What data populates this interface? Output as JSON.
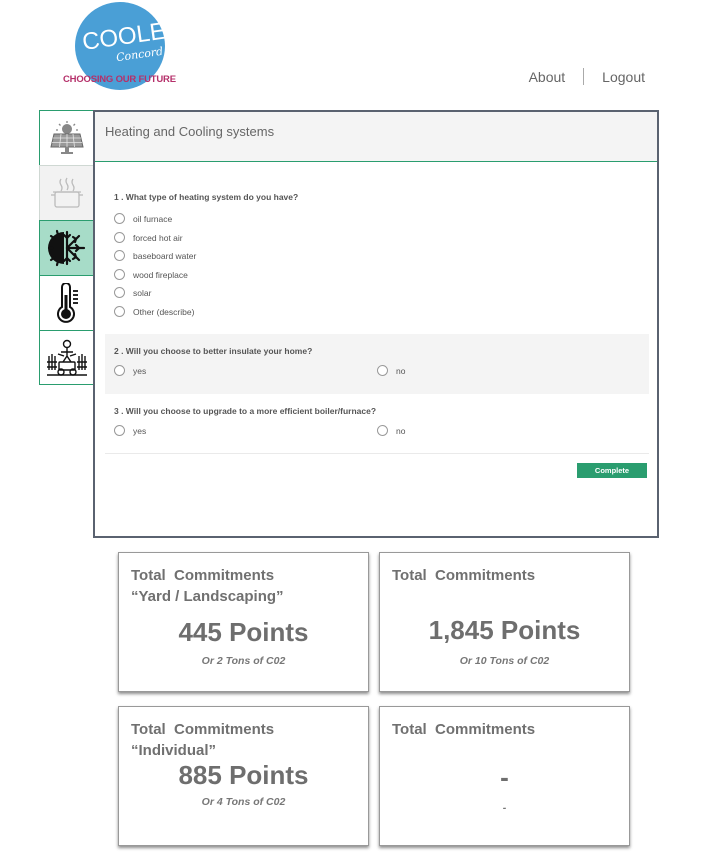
{
  "header": {
    "logo": {
      "line1": "COOLER",
      "line2": "Concord",
      "tagline": "CHOOSING OUR FUTURE"
    },
    "nav": [
      {
        "label": "About"
      },
      {
        "label": "Logout"
      }
    ]
  },
  "sidebar": {
    "items": [
      {
        "icon": "solar-panel-icon",
        "state": "normal"
      },
      {
        "icon": "cooking-pot-icon",
        "state": "faded"
      },
      {
        "icon": "heating-cooling-icon",
        "state": "active"
      },
      {
        "icon": "thermometer-icon",
        "state": "normal"
      },
      {
        "icon": "lawn-mower-icon",
        "state": "normal"
      }
    ]
  },
  "panel": {
    "title": "Heating and Cooling systems",
    "questions": [
      {
        "title": "1 .  What type of heating system do you have?",
        "options": [
          "oil furnace",
          "forced hot air",
          "baseboard water",
          "wood fireplace",
          "solar",
          "Other (describe)"
        ]
      },
      {
        "title": "2 .  Will you choose to better insulate your home?",
        "options": [
          "yes",
          "no"
        ]
      },
      {
        "title": "3 .  Will you choose to upgrade to a more efficient boiler/furnace?",
        "options": [
          "yes",
          "no"
        ]
      }
    ],
    "complete_label": "Complete"
  },
  "cards": [
    {
      "header": "Total  Commitments\n“Yard / Landscaping”",
      "points": "445 Points",
      "sub": "Or 2 Tons of C02"
    },
    {
      "header": "Total  Commitments",
      "points": "1,845 Points",
      "sub": "Or 10 Tons of C02"
    },
    {
      "header": "Total  Commitments\n“Individual”",
      "points": "885 Points",
      "sub": "Or 4 Tons of C02"
    },
    {
      "header": "Total  Commitments",
      "points": "-",
      "sub": "-"
    }
  ],
  "colors": {
    "accent": "#2a9d6f",
    "active_tab": "#a7dcc8",
    "logo_blue": "#4a9fd6",
    "logo_magenta": "#b5306a"
  }
}
